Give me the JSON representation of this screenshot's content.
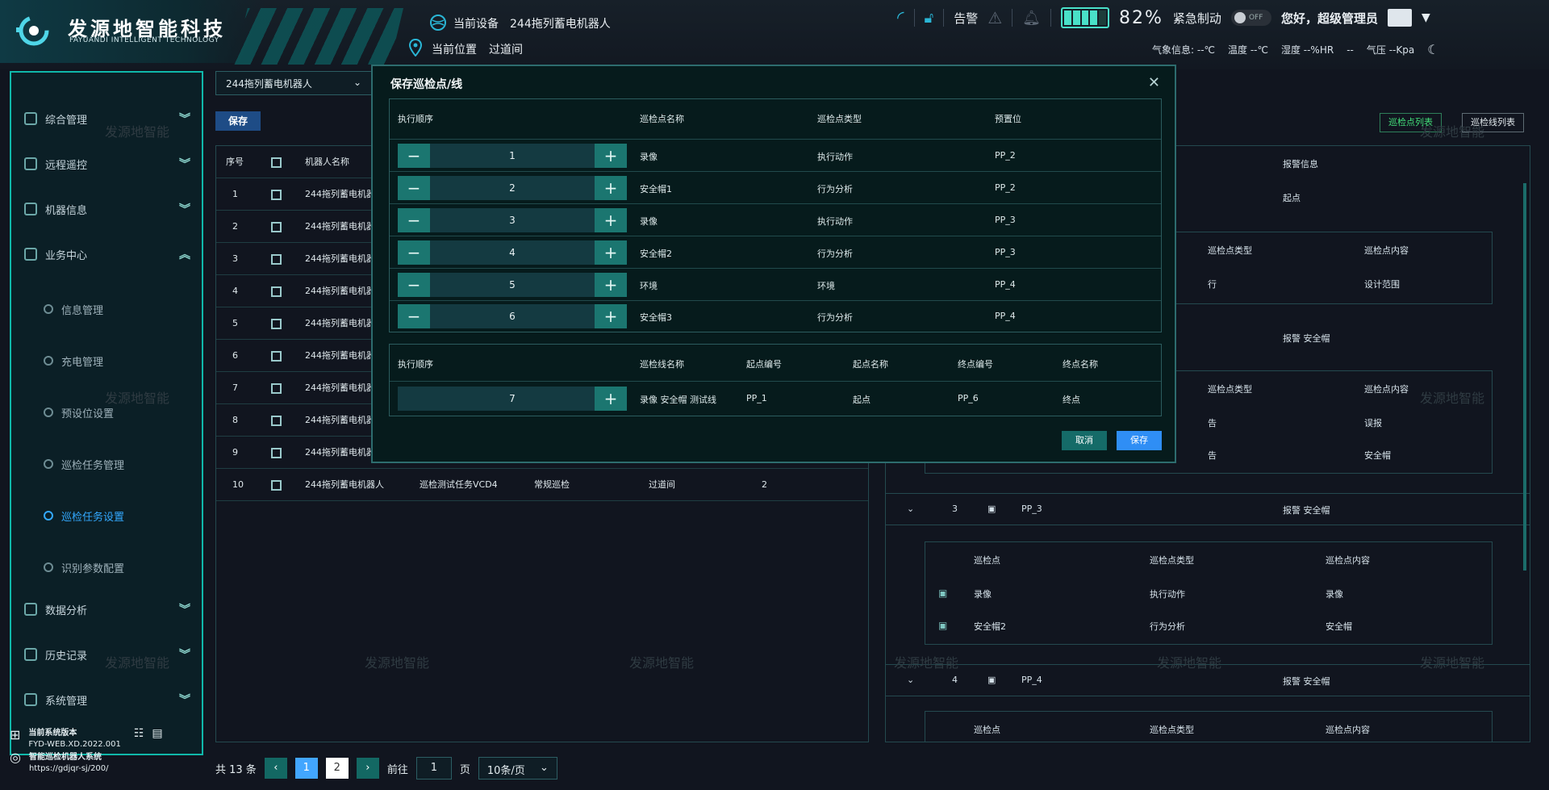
{
  "logo": {
    "cn": "发源地智能科技",
    "en": "FAYUANDI INTELLIGENT TECHNOLOGY"
  },
  "header": {
    "device_label": "当前设备",
    "device_value": "244拖列蓄电机器人",
    "location_label": "当前位置",
    "location_value": "过道间",
    "alarm": "告警",
    "battery_pct": "82%",
    "battery_level": 0.82,
    "estop": "紧急制动",
    "toggle": "OFF",
    "greeting": "您好，",
    "user": "超级管理员",
    "weather": {
      "label": "气象信息: --℃",
      "temp": "温度 --℃",
      "humidity": "湿度 --%HR",
      "wind": "--",
      "pressure": "气压 --Kpa"
    }
  },
  "sidebar": {
    "items": [
      {
        "label": "综合管理",
        "chev": "︾"
      },
      {
        "label": "远程遥控",
        "chev": "︾"
      },
      {
        "label": "机器信息",
        "chev": "︾"
      },
      {
        "label": "业务中心",
        "chev": "︽"
      },
      {
        "label": "数据分析",
        "chev": "︾"
      },
      {
        "label": "历史记录",
        "chev": "︾"
      },
      {
        "label": "系统管理",
        "chev": "︾"
      }
    ],
    "subitems": [
      "信息管理",
      "充电管理",
      "预设位设置",
      "巡检任务管理",
      "巡检任务设置",
      "识别参数配置"
    ],
    "footer": {
      "version_title": "当前系统版本",
      "version": "FYD-WEB.XD.2022.001",
      "system": "智能巡检机器人系统",
      "url": "https://gdjqr-sj/200/"
    }
  },
  "main": {
    "device_select": "244拖列蓄电机器人",
    "save": "保存",
    "headers": [
      "序号",
      "",
      "机器人名称"
    ],
    "rows": [
      {
        "idx": "1",
        "name": "244拖列蓄电机器人",
        "checked": true
      },
      {
        "idx": "2",
        "name": "244拖列蓄电机器人",
        "checked": false
      },
      {
        "idx": "3",
        "name": "244拖列蓄电机器人",
        "checked": false
      },
      {
        "idx": "4",
        "name": "244拖列蓄电机器人",
        "checked": false
      },
      {
        "idx": "5",
        "name": "244拖列蓄电机器人",
        "checked": false
      },
      {
        "idx": "6",
        "name": "244拖列蓄电机器人",
        "checked": false
      },
      {
        "idx": "7",
        "name": "244拖列蓄电机器人",
        "checked": false
      },
      {
        "idx": "8",
        "name": "244拖列蓄电机器人",
        "checked": false
      },
      {
        "idx": "9",
        "name": "244拖列蓄电机器人",
        "checked": false
      },
      {
        "idx": "10",
        "name": "244拖列蓄电机器人",
        "checked": false
      }
    ],
    "row10_extra": [
      "巡检测试任务VCD4",
      "常规巡检",
      "过道间",
      "2"
    ],
    "pager": {
      "total": "共 13 条",
      "pages": [
        "1",
        "2"
      ],
      "goto": "前往",
      "goto_value": "1",
      "page_unit": "页",
      "size": "10条/页"
    }
  },
  "right": {
    "btn1": "巡检点列表",
    "btn2": "巡检线列表",
    "col_header": "报警信息",
    "start": "起点",
    "sub_headers": [
      "巡检点类型",
      "巡检点内容"
    ],
    "sub_row1": [
      "行",
      "设计范围"
    ],
    "alarm_cell": "报警 安全帽",
    "sub_headers2": [
      "巡检点类型",
      "巡检点内容"
    ],
    "sub_rows2": [
      [
        "告",
        "误报"
      ],
      [
        "告",
        "安全帽"
      ]
    ],
    "group3": {
      "idx": "3",
      "pp": "PP_3",
      "alarm": "报警 安全帽"
    },
    "g3_headers": [
      "巡检点",
      "巡检点类型",
      "巡检点内容"
    ],
    "g3_rows": [
      [
        "录像",
        "执行动作",
        "录像"
      ],
      [
        "安全帽2",
        "行为分析",
        "安全帽"
      ]
    ],
    "group4": {
      "idx": "4",
      "pp": "PP_4",
      "alarm": "报警 安全帽"
    },
    "g4_headers": [
      "巡检点",
      "巡检点类型",
      "巡检点内容"
    ]
  },
  "modal": {
    "title": "保存巡检点/线",
    "close": "✕",
    "t1_headers": [
      "执行顺序",
      "巡检点名称",
      "巡检点类型",
      "预置位"
    ],
    "t1_rows": [
      {
        "order": "1",
        "name": "录像",
        "type": "执行动作",
        "preset": "PP_2"
      },
      {
        "order": "2",
        "name": "安全帽1",
        "type": "行为分析",
        "preset": "PP_2"
      },
      {
        "order": "3",
        "name": "录像",
        "type": "执行动作",
        "preset": "PP_3"
      },
      {
        "order": "4",
        "name": "安全帽2",
        "type": "行为分析",
        "preset": "PP_3"
      },
      {
        "order": "5",
        "name": "环境",
        "type": "环境",
        "preset": "PP_4"
      },
      {
        "order": "6",
        "name": "安全帽3",
        "type": "行为分析",
        "preset": "PP_4"
      }
    ],
    "t2_headers": [
      "执行顺序",
      "巡检线名称",
      "起点编号",
      "起点名称",
      "终点编号",
      "终点名称"
    ],
    "t2_row": {
      "order": "7",
      "name": "录像 安全帽 测试线",
      "start_no": "PP_1",
      "start_name": "起点",
      "end_no": "PP_6",
      "end_name": "终点"
    },
    "cancel": "取消",
    "ok": "保存"
  },
  "watermark": "发源地智能"
}
